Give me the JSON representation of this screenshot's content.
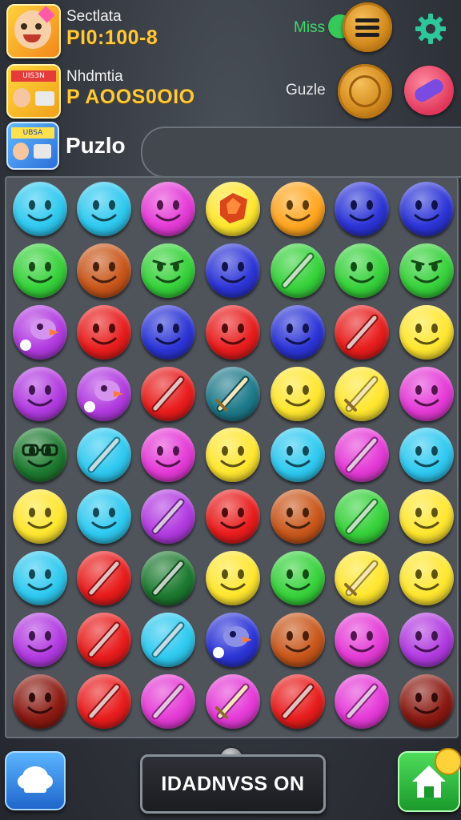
{
  "players": [
    {
      "name": "Sectlata",
      "score": "PI0:100-8"
    },
    {
      "name": "Nhdmtia",
      "score": "P AOOS0OIO"
    }
  ],
  "puzzle_label": "Puzlo",
  "mini_tile_texts": {
    "tile_b": "UIS3N",
    "tile_c": "UBSA"
  },
  "right_labels": {
    "miss": "Miss",
    "guzle": "Guzle"
  },
  "main_button_label": "IDADNVSS ON",
  "colors": {
    "score": "#ffc93a",
    "miss": "#3fdc6a",
    "coin": "#d48b1f"
  },
  "board": {
    "rows": [
      [
        "cyan-smiley",
        "cyan-smiley",
        "magenta-smiley",
        "yellow-fox",
        "orange-smiley",
        "blue-smiley",
        "blue-smiley"
      ],
      [
        "green-smiley",
        "brown-smiley",
        "green-angry",
        "blue-smiley",
        "green-stick",
        "green-smiley",
        "green-angry"
      ],
      [
        "purple-bird",
        "red-smiley",
        "blue-smiley",
        "red-smiley",
        "blue-smiley",
        "red-stick",
        "yellow-smiley"
      ],
      [
        "purple-smiley",
        "purple-bird",
        "red-stick",
        "teal-sword",
        "yellow-smiley",
        "yellow-sword",
        "magenta-smiley"
      ],
      [
        "darkgreen-glasses",
        "cyan-stick",
        "magenta-smiley",
        "yellow-smiley",
        "cyan-smiley",
        "magenta-stick",
        "cyan-smiley"
      ],
      [
        "yellow-smiley",
        "cyan-smiley",
        "purple-stick",
        "red-smiley",
        "brown-smiley",
        "green-stick",
        "yellow-smiley"
      ],
      [
        "cyan-smiley",
        "red-stick",
        "darkgreen-stick",
        "yellow-smiley",
        "green-smiley",
        "yellow-sword",
        "yellow-smiley"
      ],
      [
        "purple-smiley",
        "red-stick",
        "cyan-stick",
        "blue-bird",
        "brown-smiley",
        "magenta-smiley",
        "purple-smiley"
      ],
      [
        "darkred-smiley",
        "red-stick",
        "magenta-stick",
        "magenta-sword",
        "red-stick",
        "magenta-stick",
        "darkred-smiley"
      ]
    ]
  },
  "icons": [
    "settings-gear-icon",
    "menu-coin-icon",
    "coin-icon",
    "candy-icon",
    "chat-icon",
    "home-icon",
    "knob-icon"
  ]
}
